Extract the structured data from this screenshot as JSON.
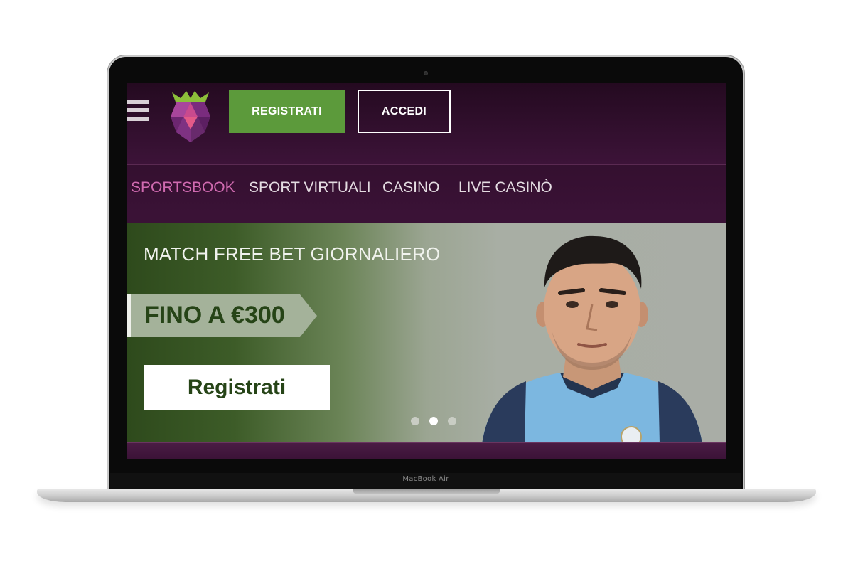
{
  "device": {
    "model_label": "MacBook Air"
  },
  "header": {
    "register_label": "REGISTRATI",
    "login_label": "ACCEDI",
    "logo_icon": "raspberry-logo-icon",
    "menu_icon": "hamburger-menu-icon"
  },
  "nav": {
    "items": [
      {
        "label": "SPORTSBOOK",
        "active": true
      },
      {
        "label": "SPORT VIRTUALI",
        "active": false
      },
      {
        "label": "CASINO",
        "active": false
      },
      {
        "label": "LIVE CASINÒ",
        "active": false
      }
    ]
  },
  "banner": {
    "title": "MATCH FREE BET GIORNALIERO",
    "amount": "FINO A €300",
    "cta_label": "Registrati",
    "slides_total": 3,
    "active_slide": 2
  },
  "colors": {
    "brand_purple": "#3a1236",
    "accent_pink": "#d06ab0",
    "register_green": "#5c9a3b",
    "banner_dark_green": "#264417"
  }
}
